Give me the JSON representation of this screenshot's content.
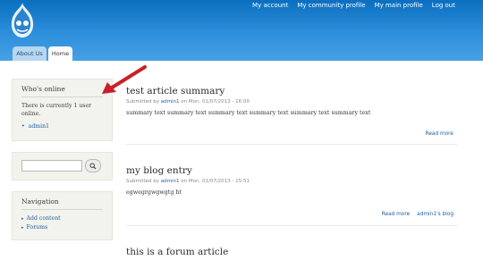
{
  "header": {
    "secondary_menu": [
      "My account",
      "My community profile",
      "My main profile",
      "Log out"
    ]
  },
  "tabs": [
    {
      "label": "About Us",
      "active": false
    },
    {
      "label": "Home",
      "active": true
    }
  ],
  "sidebar": {
    "whos_online": {
      "title": "Who's online",
      "text": "There is currently 1 user online.",
      "users": [
        "admin1"
      ]
    },
    "search": {
      "value": "",
      "button_icon": "search-icon"
    },
    "navigation": {
      "title": "Navigation",
      "items": [
        "Add content",
        "Forums"
      ]
    }
  },
  "nodes": [
    {
      "title": "test article summary",
      "submitted_prefix": "Submitted by",
      "author": "admin1",
      "date": "on Mon, 01/07/2013 - 16:00",
      "body": "summary text summary text summary text summary text summary text summary text",
      "links": [
        "Read more"
      ]
    },
    {
      "title": "my blog entry",
      "submitted_prefix": "Submitted by",
      "author": "admin1",
      "date": "on Mon, 01/07/2013 - 15:51",
      "body": "egwegrgwgwgtg ht",
      "links": [
        "Read more",
        "admin1's blog"
      ]
    },
    {
      "title": "this is a forum article"
    }
  ],
  "colors": {
    "header_top": "#0a6fc0",
    "header_bottom": "#48a0e4",
    "link": "#1d5fa6",
    "sidebar_block_bg": "#f3f3ed",
    "annotation_arrow": "#c8202a"
  }
}
